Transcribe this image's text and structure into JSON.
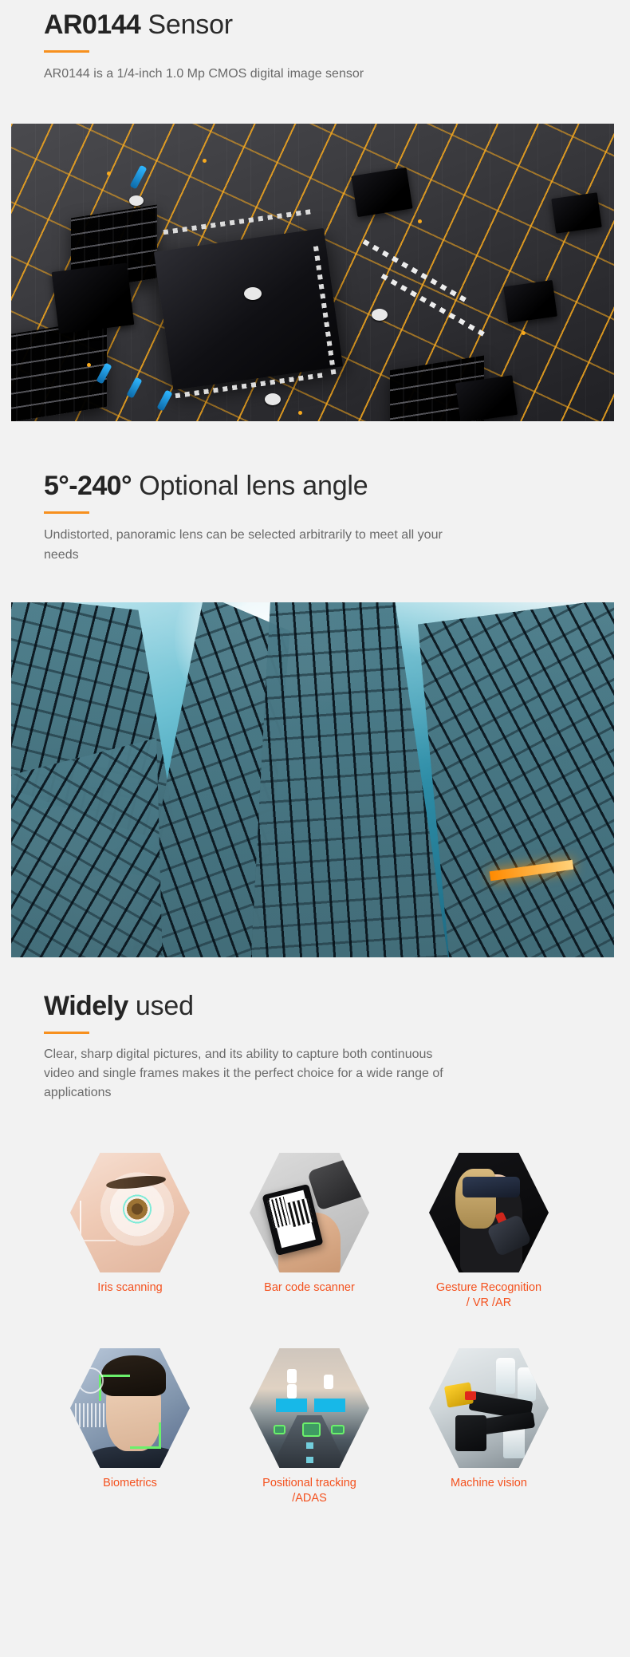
{
  "page": {
    "background_color": "#f2f2f2",
    "accent_color": "#f7901e",
    "label_color": "#f4511e",
    "heading_color": "#2b2b2b",
    "body_color": "#6a6a6a"
  },
  "sections": [
    {
      "heading_strong": "AR0144",
      "heading_rest": " Sensor",
      "body": "AR0144 is a 1/4-inch 1.0 Mp CMOS digital image  sensor",
      "image_name": "pcb-circuit-board-photo"
    },
    {
      "heading_strong": "5°-240°",
      "heading_rest": " Optional lens angle",
      "body": "Undistorted, panoramic lens can be selected arbitrarily to meet all your needs",
      "image_name": "glass-skyscraper-wide-angle-photo"
    },
    {
      "heading_strong": "Widely",
      "heading_rest": " used",
      "body": "Clear, sharp digital pictures, and its ability to capture both continuous video and single frames makes it the perfect choice for a wide range of applications"
    }
  ],
  "applications": [
    {
      "label": "Iris scanning",
      "art": "iris-scan-eye-image"
    },
    {
      "label": "Bar code scanner",
      "art": "barcode-phone-scan-image"
    },
    {
      "label": "Gesture Recognition\n/ VR /AR",
      "art": "vr-headset-gesture-image"
    },
    {
      "label": "Biometrics",
      "art": "face-recognition-image"
    },
    {
      "label": "Positional tracking /ADAS",
      "art": "adas-road-vehicles-image"
    },
    {
      "label": "Machine vision",
      "art": "robotic-arm-bottles-image"
    }
  ]
}
